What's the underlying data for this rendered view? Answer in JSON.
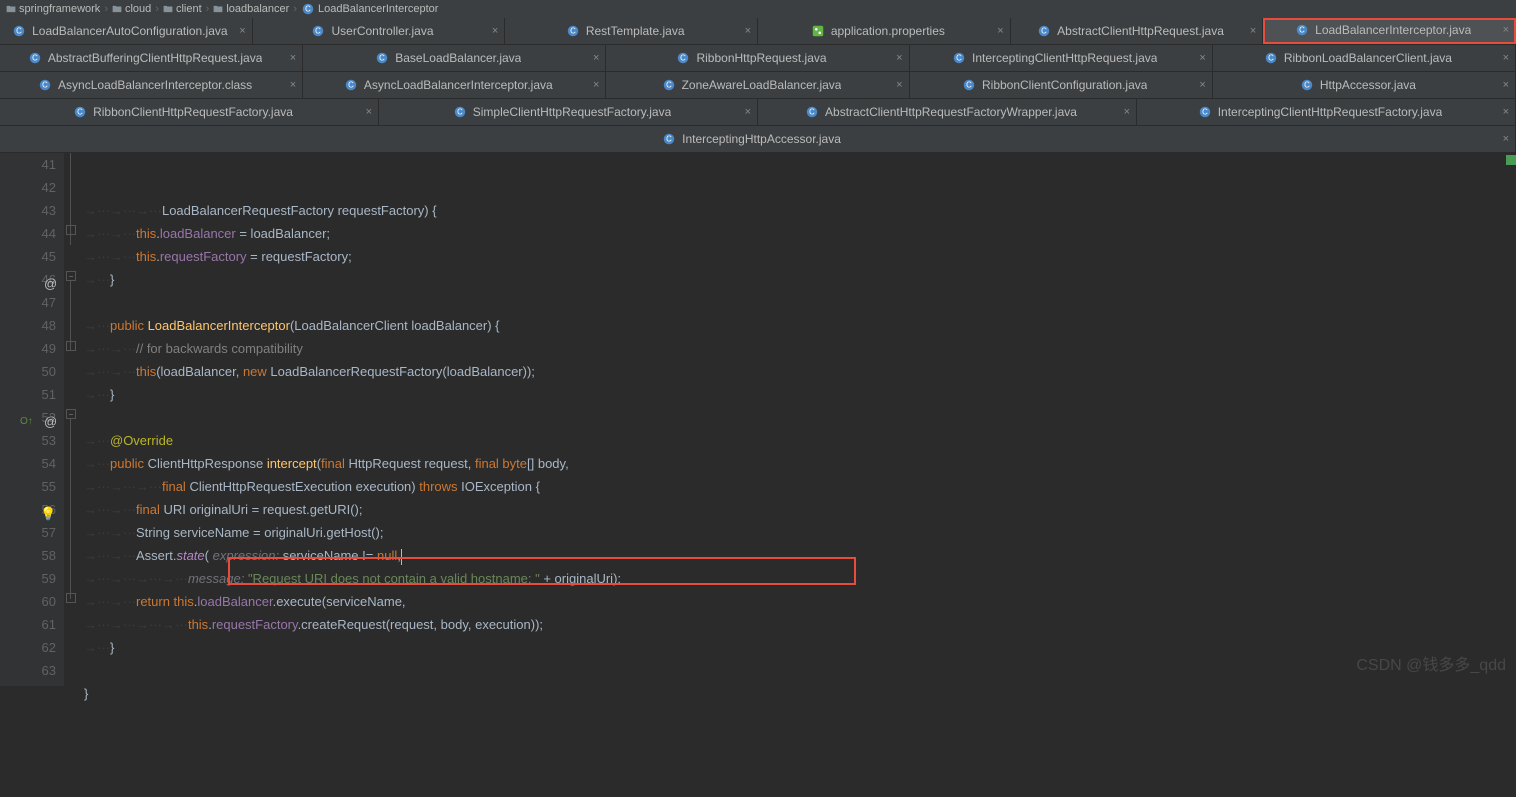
{
  "breadcrumbs": [
    {
      "label": "springframework",
      "kind": "folder"
    },
    {
      "label": "cloud",
      "kind": "folder"
    },
    {
      "label": "client",
      "kind": "folder"
    },
    {
      "label": "loadbalancer",
      "kind": "folder"
    },
    {
      "label": "LoadBalancerInterceptor",
      "kind": "class"
    }
  ],
  "tab_rows": [
    [
      {
        "label": "LoadBalancerAutoConfiguration.java",
        "kind": "class"
      },
      {
        "label": "UserController.java",
        "kind": "class"
      },
      {
        "label": "RestTemplate.java",
        "kind": "class"
      },
      {
        "label": "application.properties",
        "kind": "props"
      },
      {
        "label": "AbstractClientHttpRequest.java",
        "kind": "class"
      },
      {
        "label": "LoadBalancerInterceptor.java",
        "kind": "class",
        "active": true,
        "highlighted": true
      }
    ],
    [
      {
        "label": "AbstractBufferingClientHttpRequest.java",
        "kind": "class"
      },
      {
        "label": "BaseLoadBalancer.java",
        "kind": "class"
      },
      {
        "label": "RibbonHttpRequest.java",
        "kind": "class"
      },
      {
        "label": "InterceptingClientHttpRequest.java",
        "kind": "class"
      },
      {
        "label": "RibbonLoadBalancerClient.java",
        "kind": "class"
      }
    ],
    [
      {
        "label": "AsyncLoadBalancerInterceptor.class",
        "kind": "class"
      },
      {
        "label": "AsyncLoadBalancerInterceptor.java",
        "kind": "class"
      },
      {
        "label": "ZoneAwareLoadBalancer.java",
        "kind": "class"
      },
      {
        "label": "RibbonClientConfiguration.java",
        "kind": "class"
      },
      {
        "label": "HttpAccessor.java",
        "kind": "class"
      }
    ],
    [
      {
        "label": "RibbonClientHttpRequestFactory.java",
        "kind": "class"
      },
      {
        "label": "SimpleClientHttpRequestFactory.java",
        "kind": "class"
      },
      {
        "label": "AbstractClientHttpRequestFactoryWrapper.java",
        "kind": "class"
      },
      {
        "label": "InterceptingClientHttpRequestFactory.java",
        "kind": "class"
      }
    ],
    [
      {
        "label": "InterceptingHttpAccessor.java",
        "kind": "class"
      }
    ]
  ],
  "lines": {
    "start": 41,
    "nums": [
      "41",
      "42",
      "43",
      "44",
      "45",
      "46",
      "47",
      "48",
      "49",
      "50",
      "51",
      "52",
      "53",
      "54",
      "55",
      "56",
      "57",
      "58",
      "59",
      "60",
      "61",
      "62",
      "63"
    ]
  },
  "code": {
    "l41_pre": "            ",
    "l41_a": "LoadBalancerRequestFactory requestFactory) {",
    "l42_pre": "        ",
    "l42_kw": "this",
    "l42_a": ".",
    "l42_f": "loadBalancer",
    "l42_b": " = loadBalancer;",
    "l43_pre": "        ",
    "l43_kw": "this",
    "l43_a": ".",
    "l43_f": "requestFactory",
    "l43_b": " = requestFactory;",
    "l44_pre": "    ",
    "l44_a": "}",
    "l46_pre": "    ",
    "l46_kw": "public ",
    "l46_m": "LoadBalancerInterceptor",
    "l46_a": "(LoadBalancerClient loadBalancer) {",
    "l47_pre": "        ",
    "l47_c": "// for backwards compatibility",
    "l48_pre": "        ",
    "l48_kw": "this",
    "l48_a": "(loadBalancer, ",
    "l48_kw2": "new ",
    "l48_b": "LoadBalancerRequestFactory(loadBalancer));",
    "l49_pre": "    ",
    "l49_a": "}",
    "l51_pre": "    ",
    "l51_ann": "@Override",
    "l52_pre": "    ",
    "l52_kw": "public ",
    "l52_a": "ClientHttpResponse ",
    "l52_m": "intercept",
    "l52_b": "(",
    "l52_kw2": "final ",
    "l52_c": "HttpRequest request, ",
    "l52_kw3": "final byte",
    "l52_d": "[] body,",
    "l53_pre": "            ",
    "l53_kw": "final ",
    "l53_a": "ClientHttpRequestExecution execution) ",
    "l53_kw2": "throws ",
    "l53_b": "IOException {",
    "l54_pre": "        ",
    "l54_kw": "final ",
    "l54_a": "URI originalUri = request.getURI();",
    "l55_pre": "        ",
    "l55_a": "String serviceName = originalUri.getHost();",
    "l56_pre": "        ",
    "l56_a": "Assert.",
    "l56_m": "state",
    "l56_b": "( ",
    "l56_p": "expression: ",
    "l56_c": "serviceName != ",
    "l56_kw": "null",
    "l56_d": ",",
    "l57_pre": "                ",
    "l57_p": "message: ",
    "l57_s": "\"Request URI does not contain a valid hostname: \"",
    "l57_a": " + originalUri);",
    "l58_pre": "        ",
    "l58_kw": "return this",
    "l58_a": ".",
    "l58_f": "loadBalancer",
    "l58_b": ".execute(serviceName,",
    "l59_pre": "                ",
    "l59_kw": "this",
    "l59_a": ".",
    "l59_f": "requestFactory",
    "l59_b": ".createRequest(request, body, execution));",
    "l60_pre": "    ",
    "l60_a": "}",
    "l62_pre": "",
    "l62_a": "}"
  },
  "watermark": "CSDN @钱多多_qdd"
}
